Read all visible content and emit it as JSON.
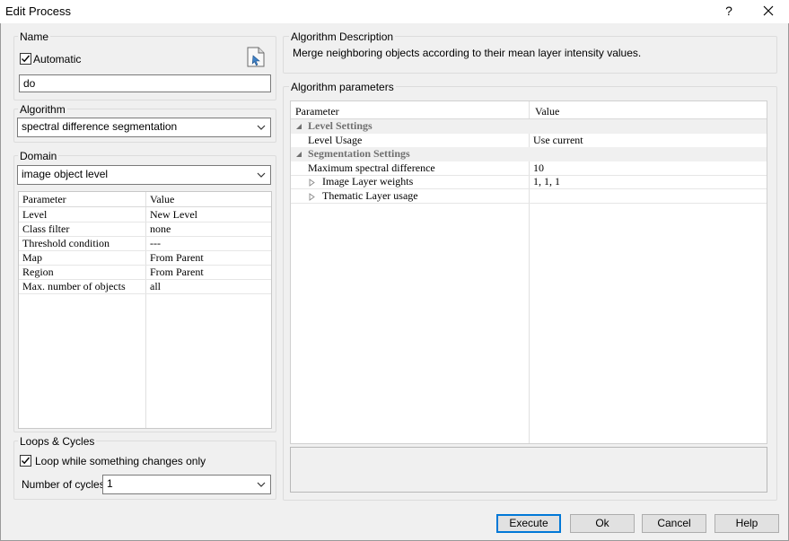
{
  "window": {
    "title": "Edit Process",
    "help_label": "?"
  },
  "name_group": {
    "label": "Name",
    "automatic_label": "Automatic",
    "automatic_checked": true,
    "name_value": "do"
  },
  "algorithm_group": {
    "label": "Algorithm",
    "selected": "spectral difference segmentation"
  },
  "domain_group": {
    "label": "Domain",
    "selected": "image object level",
    "grid": {
      "headers": [
        "Parameter",
        "Value"
      ],
      "rows": [
        {
          "param": "Level",
          "value": "New Level"
        },
        {
          "param": "Class filter",
          "value": "none"
        },
        {
          "param": "Threshold condition",
          "value": "---"
        },
        {
          "param": "Map",
          "value": "From Parent"
        },
        {
          "param": "Region",
          "value": "From Parent"
        },
        {
          "param": "Max. number of objects",
          "value": "all"
        }
      ]
    }
  },
  "loops_group": {
    "label": "Loops & Cycles",
    "loop_label": "Loop while something changes only",
    "loop_checked": true,
    "cycles_label": "Number of cycles",
    "cycles_value": "1"
  },
  "description_group": {
    "label": "Algorithm Description",
    "text": "Merge neighboring objects according to their mean layer intensity values."
  },
  "parameters_group": {
    "label": "Algorithm parameters",
    "headers": [
      "Parameter",
      "Value"
    ],
    "rows": [
      {
        "type": "section",
        "label": "Level Settings",
        "expanded": true
      },
      {
        "type": "item",
        "param": "Level Usage",
        "value": "Use current"
      },
      {
        "type": "section",
        "label": "Segmentation Settings",
        "expanded": true
      },
      {
        "type": "item",
        "param": "Maximum spectral difference",
        "value": "10"
      },
      {
        "type": "subitem",
        "param": "Image Layer weights",
        "value": "1, 1, 1"
      },
      {
        "type": "subitem",
        "param": "Thematic Layer usage",
        "value": ""
      }
    ]
  },
  "buttons": {
    "execute": "Execute",
    "ok": "Ok",
    "cancel": "Cancel",
    "help": "Help"
  }
}
